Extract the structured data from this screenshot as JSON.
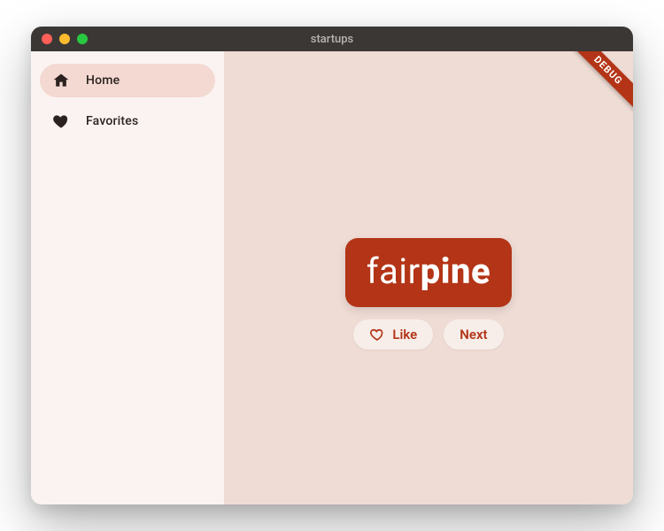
{
  "window": {
    "title": "startups"
  },
  "sidebar": {
    "items": [
      {
        "label": "Home",
        "icon": "home-icon",
        "active": true
      },
      {
        "label": "Favorites",
        "icon": "heart-icon",
        "active": false
      }
    ]
  },
  "main": {
    "startup": {
      "name_part1": "fair",
      "name_part2": "pine"
    },
    "actions": {
      "like_label": "Like",
      "next_label": "Next"
    }
  },
  "debug": {
    "banner": "DEBUG"
  },
  "colors": {
    "accent": "#b33416",
    "sidebar_bg": "#faf3f1",
    "main_bg": "#efdcd5",
    "nav_active_bg": "#f3d9d1",
    "pill_bg": "#f7eeea"
  }
}
